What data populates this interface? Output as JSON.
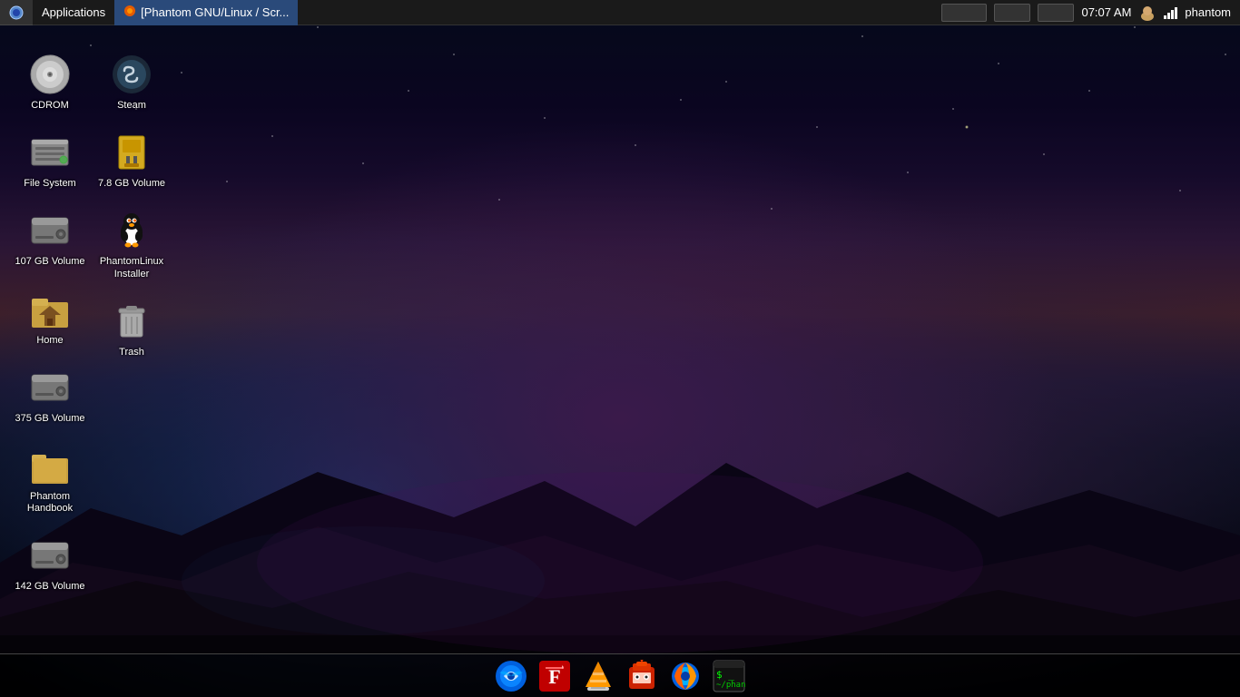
{
  "topbar": {
    "applications_label": "Applications",
    "window_title": "[Phantom GNU/Linux / Scr...",
    "clock": "07:07 AM",
    "username": "phantom"
  },
  "desktop_icons": [
    {
      "id": "cdrom",
      "label": "CDROM",
      "type": "cdrom"
    },
    {
      "id": "filesystem",
      "label": "File System",
      "type": "filesystem"
    },
    {
      "id": "vol107",
      "label": "107 GB Volume",
      "type": "hdd"
    },
    {
      "id": "home",
      "label": "Home",
      "type": "folder-home"
    },
    {
      "id": "vol375",
      "label": "375 GB Volume",
      "type": "hdd"
    },
    {
      "id": "phantom-handbook",
      "label": "Phantom Handbook",
      "type": "folder"
    },
    {
      "id": "vol142",
      "label": "142 GB Volume",
      "type": "hdd"
    },
    {
      "id": "steam",
      "label": "Steam",
      "type": "steam"
    },
    {
      "id": "vol78",
      "label": "7.8 GB Volume",
      "type": "hdd-usb"
    },
    {
      "id": "phantomlinux",
      "label": "PhantomLinux Installer",
      "type": "linux"
    },
    {
      "id": "trash",
      "label": "Trash",
      "type": "trash"
    }
  ],
  "taskbar_apps": [
    {
      "id": "thunderbird",
      "label": "Thunderbird",
      "type": "thunderbird"
    },
    {
      "id": "filezilla",
      "label": "FileZilla",
      "type": "filezilla"
    },
    {
      "id": "vlc",
      "label": "VLC Media Player",
      "type": "vlc"
    },
    {
      "id": "installer",
      "label": "Installer",
      "type": "installer"
    },
    {
      "id": "firefox",
      "label": "Firefox",
      "type": "firefox"
    },
    {
      "id": "terminal",
      "label": "Terminal",
      "type": "terminal"
    }
  ]
}
